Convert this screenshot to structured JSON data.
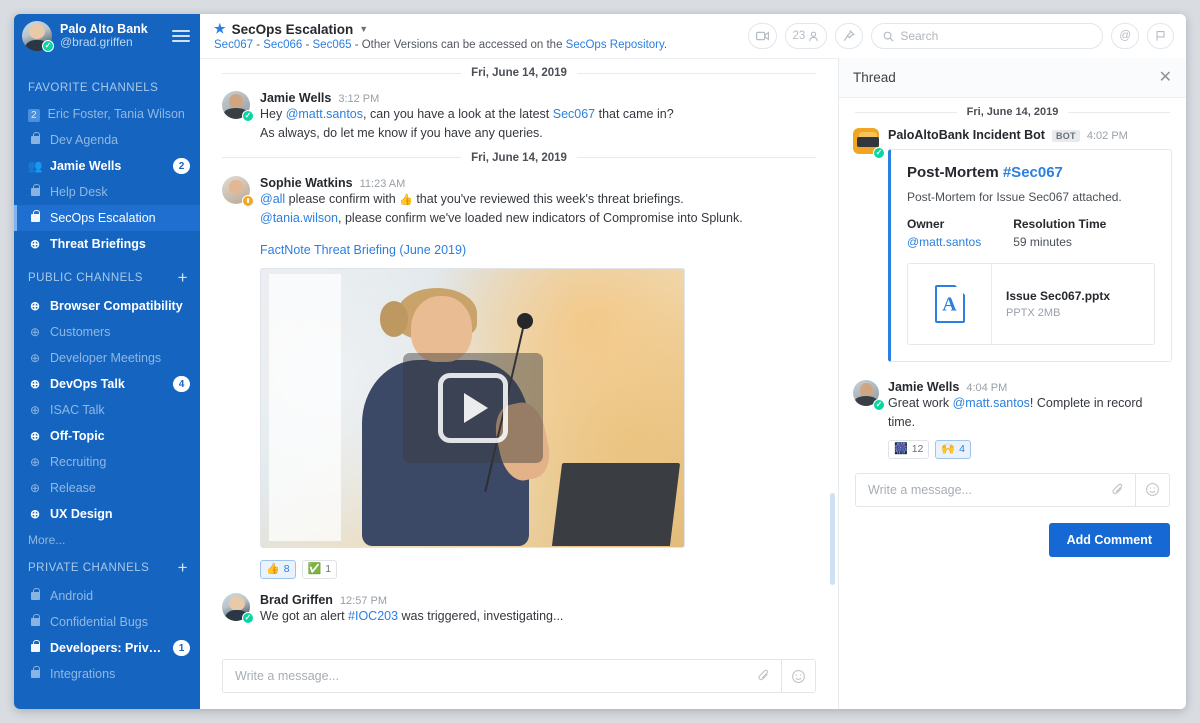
{
  "sidebar": {
    "team_name": "Palo Alto Bank",
    "user_handle": "@brad.griffen",
    "menu_icon": "hamburger-icon",
    "sections": [
      {
        "title": "FAVORITE CHANNELS",
        "has_add": false,
        "items": [
          {
            "label": "Eric Foster, Tania Wilson",
            "icon": "badge-2",
            "badge_square": "2",
            "bold": false,
            "active": false,
            "count": ""
          },
          {
            "label": "Dev Agenda",
            "icon": "lock-icon",
            "bold": false,
            "active": false,
            "count": ""
          },
          {
            "label": "Jamie Wells",
            "icon": "people-icon",
            "bold": true,
            "active": false,
            "count": "2"
          },
          {
            "label": "Help Desk",
            "icon": "lock-icon",
            "bold": false,
            "active": false,
            "count": ""
          },
          {
            "label": "SecOps Escalation",
            "icon": "lock-icon",
            "bold": false,
            "active": true,
            "count": ""
          },
          {
            "label": "Threat Briefings",
            "icon": "globe-icon",
            "bold": true,
            "active": false,
            "count": ""
          }
        ]
      },
      {
        "title": "PUBLIC CHANNELS",
        "has_add": true,
        "add_icon": "plus-icon",
        "items": [
          {
            "label": "Browser Compatibility",
            "icon": "globe-icon",
            "bold": true,
            "active": false,
            "count": ""
          },
          {
            "label": "Customers",
            "icon": "globe-icon",
            "bold": false,
            "active": false,
            "count": ""
          },
          {
            "label": "Developer Meetings",
            "icon": "globe-icon",
            "bold": false,
            "active": false,
            "count": ""
          },
          {
            "label": "DevOps Talk",
            "icon": "globe-icon",
            "bold": true,
            "active": false,
            "count": "4"
          },
          {
            "label": "ISAC Talk",
            "icon": "globe-icon",
            "bold": false,
            "active": false,
            "count": ""
          },
          {
            "label": "Off-Topic",
            "icon": "globe-icon",
            "bold": true,
            "active": false,
            "count": ""
          },
          {
            "label": "Recruiting",
            "icon": "globe-icon",
            "bold": false,
            "active": false,
            "count": ""
          },
          {
            "label": "Release",
            "icon": "globe-icon",
            "bold": false,
            "active": false,
            "count": ""
          },
          {
            "label": "UX Design",
            "icon": "globe-icon",
            "bold": true,
            "active": false,
            "count": ""
          }
        ],
        "more_label": "More..."
      },
      {
        "title": "PRIVATE CHANNELS",
        "has_add": true,
        "add_icon": "plus-icon",
        "items": [
          {
            "label": "Android",
            "icon": "lock-icon",
            "bold": false,
            "active": false,
            "count": ""
          },
          {
            "label": "Confidential Bugs",
            "icon": "lock-icon",
            "bold": false,
            "active": false,
            "count": ""
          },
          {
            "label": "Developers: Private",
            "icon": "lock-icon",
            "bold": true,
            "active": false,
            "count": "1"
          },
          {
            "label": "Integrations",
            "icon": "lock-icon",
            "bold": false,
            "active": false,
            "count": ""
          }
        ]
      }
    ]
  },
  "header": {
    "channel_name": "SecOps Escalation",
    "star_icon": "star-icon",
    "caret_icon": "chevron-down-icon",
    "subtitle_links": [
      "Sec067",
      "Sec066",
      "Sec065"
    ],
    "subtitle_mid": " - Other Versions can be accessed on the ",
    "subtitle_link_last": "SecOps Repository",
    "subtitle_end": ".",
    "sep": " - ",
    "video_icon": "video-camera-icon",
    "members_count": "23",
    "members_icon": "person-icon",
    "pin_icon": "pin-icon",
    "search_placeholder": "Search",
    "search_value": "",
    "search_icon": "search-icon",
    "mention_icon": "at-icon",
    "flag_icon": "flag-icon"
  },
  "main": {
    "date_divider_1": "Fri, June 14, 2019",
    "date_divider_2": "Fri, June 14, 2019",
    "messages": [
      {
        "author": "Jamie Wells",
        "time": "3:12 PM",
        "status": "online",
        "line1_a": "Hey ",
        "line1_mention": "@matt.santos",
        "line1_b": ", can you have a look at the latest ",
        "line1_link": "Sec067",
        "line1_c": " that came in?",
        "line2": "As always, do let me know if you have any queries."
      },
      {
        "author": "Sophie Watkins",
        "time": "11:23 AM",
        "status": "away",
        "line1_mention": "@all",
        "line1_a": " please confirm with ",
        "line1_emoji": "👍",
        "line1_b": " that you've reviewed this week's threat briefings.",
        "line2_mention": "@tania.wilson",
        "line2_b": ", please confirm we've loaded new indicators of Compromise into Splunk.",
        "attachment_link": "FactNote Threat Briefing (June 2019)",
        "video_alt": "video-thumbnail",
        "play_icon": "play-icon",
        "reactions": [
          {
            "emoji": "👍",
            "count": "8",
            "selected": true
          },
          {
            "emoji": "✅",
            "count": "1",
            "selected": false
          }
        ]
      },
      {
        "author": "Brad Griffen",
        "time": "12:57 PM",
        "status": "online",
        "line1_a": "We got an alert ",
        "line1_link": "#IOC203",
        "line1_b": " was triggered, investigating..."
      }
    ],
    "composer_placeholder": "Write a message...",
    "composer_value": "",
    "attach_icon": "paperclip-icon",
    "emoji_icon": "smiley-icon"
  },
  "thread": {
    "title": "Thread",
    "close_icon": "close-icon",
    "date_divider": "Fri, June 14, 2019",
    "bot_message": {
      "author": "PaloAltoBank Incident Bot",
      "tag": "BOT",
      "time": "4:02 PM",
      "status": "online",
      "card": {
        "title_main": "Post-Mortem ",
        "title_hash": "#Sec067",
        "subtitle": "Post-Mortem for Issue Sec067 attached.",
        "field_owner_label": "Owner",
        "field_owner_value": "@matt.santos",
        "field_time_label": "Resolution Time",
        "field_time_value": "59 minutes",
        "file_icon": "pdf-document-icon",
        "file_name": "Issue Sec067.pptx",
        "file_size": "PPTX 2MB"
      }
    },
    "reply": {
      "author": "Jamie Wells",
      "time": "4:04 PM",
      "status": "online",
      "text_a": "Great work ",
      "mention": "@matt.santos",
      "text_b": "! Complete in record time.",
      "reactions": [
        {
          "emoji": "🎆",
          "count": "12",
          "selected": false
        },
        {
          "emoji": "🙌",
          "count": "4",
          "selected": true
        }
      ]
    },
    "composer_placeholder": "Write a message...",
    "composer_value": "",
    "attach_icon": "paperclip-icon",
    "emoji_icon": "smiley-icon",
    "add_comment_label": "Add Comment"
  },
  "colors": {
    "sidebar_bg": "#1565c0",
    "sidebar_active": "#1e6fd0",
    "accent_blue": "#2a7fe0",
    "primary_button": "#1668d4",
    "online_green": "#06d6a0",
    "away_orange": "#f5a623"
  }
}
